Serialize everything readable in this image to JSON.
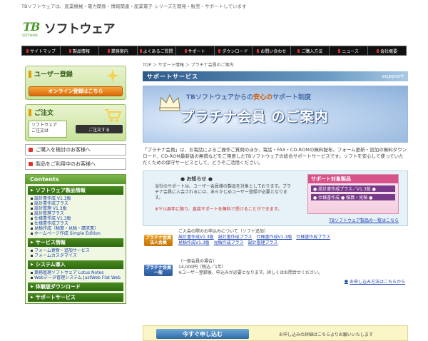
{
  "tagline": "TBソフトウェアは、産業機械・電力関係・情報関連・産業電子 シリーズを開発・販売・サポートしています",
  "logo": {
    "mark": "TB",
    "mark_sub": "SOFTWARE",
    "name": "ソフトウェア"
  },
  "global_nav": [
    "サイトマップ",
    "製品情報",
    "業務案内",
    "よくあるご質問",
    "サポート",
    "ダウンロード",
    "お問い合わせ",
    "ご購入方法",
    "ニュース",
    "会社概要"
  ],
  "sidebar": {
    "user_box": {
      "title": "ユーザー登録",
      "button": "オンライン登録はこちら"
    },
    "order_box": {
      "title": "ご注文",
      "product_label": "ソフトウェア\nご注文は",
      "button": "ご注文する"
    },
    "links": [
      "ご購入を検討のお客様へ",
      "製品をご利用中のお客様へ"
    ],
    "contents_title": "Contents",
    "sections": [
      {
        "title": "ソフトウェア製品情報",
        "items": [
          "設計書作成 V1.3版",
          "設計書作成プラス",
          "設計管理 V1.3版",
          "設計管理プラス",
          "仕様書作成 V1.3版",
          "仕様書作成プラス",
          "見積作成（積算・見積・請求書）",
          "ホームページ作成 Simple Edition"
        ]
      },
      {
        "title": "サービス情報",
        "items": [
          "フォーム更新・追加サービス",
          "フォームカスタマイズ"
        ]
      },
      {
        "title": "システム導入",
        "items": [
          "業務管理ソフトウェア Lotus Notes",
          "Webデータ管理システム JustWeb Flat Web"
        ]
      },
      {
        "title": "体験版ダウンロード",
        "items": []
      },
      {
        "title": "サポートサービス",
        "items": []
      }
    ]
  },
  "main": {
    "breadcrumb": "TOP ＞ サポート情報 ＞ プラチナ会員のご案内",
    "section_title": "サポートサービス",
    "section_title_en": "support",
    "banner": {
      "top_pre": "TBソフトウェアからの",
      "top_hi": "安心の",
      "top_post": "サポート制度",
      "main": "プラチナ会員 のご案内"
    },
    "intro": "「プラチナ会員」は、お電話によるご操作ご質問のほか、電話・FAX・CD-ROMの無料配布、フォーム更新・追加の無料ダウンロード、CD-ROM最新版の無償などをご用意したTBソフトウェアの総合サポートサービスです。ソフトを安心して使っていただくための保守サービスとして、どうぞご活用ください。",
    "info": {
      "title": "● お知らせ ●",
      "text": "当社のサポートは、ユーザー会員様の製品を対象としております。プラチナ会員に入会されるには、あらかじめユーザー登録が必要となります。",
      "note": "※ヤル周年に限り、直接サポートを無料で受けることができます。",
      "promo_title": "サポート対象製品",
      "promo_lines": [
        "● 設計書作成プラス／V1.3版 ●",
        "● 仕様書作成 ● 積算・見積 ●"
      ],
      "promo_link": "TBソフトウェア製品の一覧はこちら"
    },
    "members": [
      {
        "tag": "プラチナ会員 法人会員",
        "tag_color": "#c47008",
        "line1": "ご入会の際のお申込みについて（ソフト追加）",
        "links1": [
          "設計書作成V1.3版",
          "設計書作成プラス",
          "仕様書作成V1.3版",
          "仕様書作成プラス"
        ],
        "links2": [
          "見積作成V1.3版",
          "見積作成プラス",
          "設計管理プラス"
        ]
      },
      {
        "tag": "プラチナ会員 一般",
        "tag_color": "#2a5a9a",
        "line1": "（一般会員の場合）",
        "line2": "14,000円（税込／1年）",
        "line3": "※ユーザー登録後、申込みが必要となります。詳しくはお問合せください。",
        "apply": "お申し込み方法はこちらから"
      }
    ]
  },
  "cta": {
    "button": "今すぐ申し込む",
    "text": "お申し込みの詳細はこちらよりお願いいたします"
  }
}
